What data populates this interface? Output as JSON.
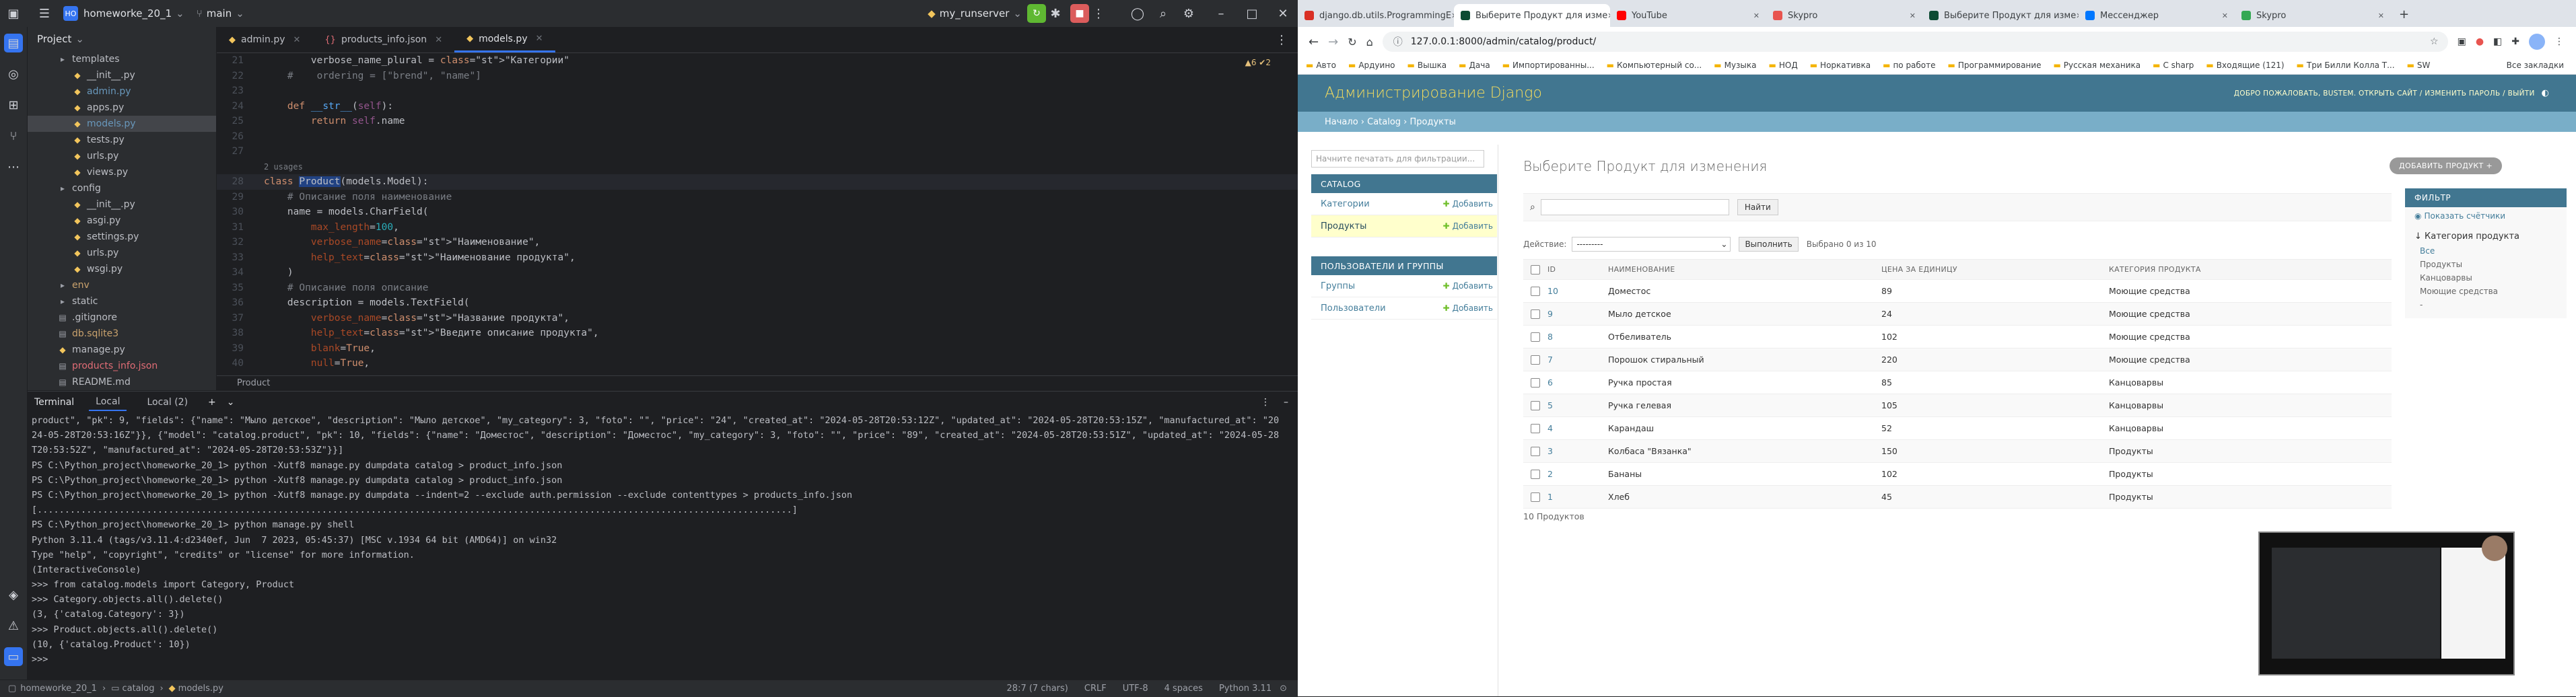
{
  "ide": {
    "project_name": "homeworke_20_1",
    "project_badge": "HO",
    "branch": "main",
    "run_config": "my_runserver",
    "project_panel_title": "Project",
    "tree": [
      {
        "name": "templates",
        "indent": 2,
        "icon": "folder"
      },
      {
        "name": "__init__.py",
        "indent": 3,
        "icon": "py"
      },
      {
        "name": "admin.py",
        "indent": 3,
        "icon": "py",
        "color": "#6897bb"
      },
      {
        "name": "apps.py",
        "indent": 3,
        "icon": "py"
      },
      {
        "name": "models.py",
        "indent": 3,
        "icon": "py",
        "color": "#6897bb",
        "selected": true
      },
      {
        "name": "tests.py",
        "indent": 3,
        "icon": "py"
      },
      {
        "name": "urls.py",
        "indent": 3,
        "icon": "py"
      },
      {
        "name": "views.py",
        "indent": 3,
        "icon": "py"
      },
      {
        "name": "config",
        "indent": 2,
        "icon": "folder"
      },
      {
        "name": "__init__.py",
        "indent": 3,
        "icon": "py"
      },
      {
        "name": "asgi.py",
        "indent": 3,
        "icon": "py"
      },
      {
        "name": "settings.py",
        "indent": 3,
        "icon": "py"
      },
      {
        "name": "urls.py",
        "indent": 3,
        "icon": "py"
      },
      {
        "name": "wsgi.py",
        "indent": 3,
        "icon": "py"
      },
      {
        "name": "env",
        "indent": 2,
        "icon": "folder",
        "color": "#c9a26d"
      },
      {
        "name": "static",
        "indent": 2,
        "icon": "folder"
      },
      {
        "name": ".gitignore",
        "indent": 2,
        "icon": "file"
      },
      {
        "name": "db.sqlite3",
        "indent": 2,
        "icon": "file",
        "color": "#c9a26d"
      },
      {
        "name": "manage.py",
        "indent": 2,
        "icon": "py"
      },
      {
        "name": "products_info.json",
        "indent": 2,
        "icon": "file",
        "color": "#e06c75"
      },
      {
        "name": "README.md",
        "indent": 2,
        "icon": "file"
      }
    ],
    "tabs": [
      {
        "label": "admin.py",
        "active": false
      },
      {
        "label": "products_info.json",
        "active": false
      },
      {
        "label": "models.py",
        "active": true
      }
    ],
    "inspections": "▲6 ✔2",
    "usages_hint": "2 usages",
    "code_lines": [
      {
        "n": "21",
        "t": "        verbose_name_plural = \"Категории\""
      },
      {
        "n": "22",
        "t": "    #    ordering = [\"brend\", \"name\"]"
      },
      {
        "n": "23",
        "t": ""
      },
      {
        "n": "24",
        "t": "    def __str__(self):"
      },
      {
        "n": "25",
        "t": "        return self.name"
      },
      {
        "n": "26",
        "t": ""
      },
      {
        "n": "27",
        "t": ""
      },
      {
        "n": "28",
        "t": "class Product(models.Model):"
      },
      {
        "n": "29",
        "t": "    # Описание поля наименование"
      },
      {
        "n": "30",
        "t": "    name = models.CharField("
      },
      {
        "n": "31",
        "t": "        max_length=100,"
      },
      {
        "n": "32",
        "t": "        verbose_name=\"Наименование\","
      },
      {
        "n": "33",
        "t": "        help_text=\"Наименование продукта\","
      },
      {
        "n": "34",
        "t": "    )"
      },
      {
        "n": "35",
        "t": "    # Описание поля описание"
      },
      {
        "n": "36",
        "t": "    description = models.TextField("
      },
      {
        "n": "37",
        "t": "        verbose_name=\"Название продукта\","
      },
      {
        "n": "38",
        "t": "        help_text=\"Введите описание продукта\","
      },
      {
        "n": "39",
        "t": "        blank=True,"
      },
      {
        "n": "40",
        "t": "        null=True,"
      }
    ],
    "editor_breadcrumb": "Product",
    "terminal": {
      "title": "Terminal",
      "tabs": [
        "Local",
        "Local (2)"
      ],
      "lines": [
        "product\", \"pk\": 9, \"fields\": {\"name\": \"Мыло детское\", \"description\": \"Мыло детское\", \"my_category\": 3, \"foto\": \"\", \"price\": \"24\", \"created_at\": \"2024-05-28T20:53:12Z\", \"updated_at\": \"2024-05-28T20:53:15Z\", \"manufactured_at\": \"20",
        "24-05-28T20:53:16Z\"}}, {\"model\": \"catalog.product\", \"pk\": 10, \"fields\": {\"name\": \"Доместос\", \"description\": \"Доместос\", \"my_category\": 3, \"foto\": \"\", \"price\": \"89\", \"created_at\": \"2024-05-28T20:53:51Z\", \"updated_at\": \"2024-05-28",
        "T20:53:52Z\", \"manufactured_at\": \"2024-05-28T20:53:53Z\"}}]",
        "PS C:\\Python_project\\homeworke_20_1> python -Xutf8 manage.py dumpdata catalog > product_info.json",
        "PS C:\\Python_project\\homeworke_20_1> python -Xutf8 manage.py dumpdata catalog > product_info.json",
        "PS C:\\Python_project\\homeworke_20_1> python -Xutf8 manage.py dumpdata --indent=2 --exclude auth.permission --exclude contenttypes > products_info.json",
        "[..........................................................................................................................................]",
        "PS C:\\Python_project\\homeworke_20_1> python manage.py shell",
        "Python 3.11.4 (tags/v3.11.4:d2340ef, Jun  7 2023, 05:45:37) [MSC v.1934 64 bit (AMD64)] on win32",
        "Type \"help\", \"copyright\", \"credits\" or \"license\" for more information.",
        "(InteractiveConsole)",
        ">>> from catalog.models import Category, Product",
        ">>> Category.objects.all().delete()",
        "(3, {'catalog.Category': 3})",
        ">>> Product.objects.all().delete()",
        "(10, {'catalog.Product': 10})",
        ">>> "
      ]
    },
    "status": {
      "path": [
        "homeworke_20_1",
        "catalog",
        "models.py"
      ],
      "position": "28:7 (7 chars)",
      "line_ending": "CRLF",
      "encoding": "UTF-8",
      "indent": "4 spaces",
      "interpreter": "Python 3.11"
    }
  },
  "browser": {
    "tabs": [
      {
        "label": "django.db.utils.ProgrammingE",
        "fav": "#d93025",
        "active": false
      },
      {
        "label": "Выберите Продукт для изме",
        "fav": "#0c4b33",
        "active": true
      },
      {
        "label": "YouTube",
        "fav": "#ff0000",
        "active": false
      },
      {
        "label": "Skypro",
        "fav": "#e8544f",
        "active": false
      },
      {
        "label": "Выберите Продукт для изме",
        "fav": "#0c4b33",
        "active": false
      },
      {
        "label": "Мессенджер",
        "fav": "#0077ff",
        "active": false
      },
      {
        "label": "Skypro",
        "fav": "#34a853",
        "active": false
      }
    ],
    "url": "127.0.0.1:8000/admin/catalog/product/",
    "bookmarks": [
      "Авто",
      "Ардуино",
      "Вышка",
      "Дача",
      "Импортированны...",
      "Компьютерный со...",
      "Музыка",
      "НОД",
      "Норкативка",
      "по работе",
      "Программирование",
      "Русская механика",
      "C sharp",
      "Входящие (121)",
      "Три Билли Колла Т...",
      "SW"
    ],
    "bookmarks_right": "Все закладки"
  },
  "django": {
    "brand": "Администрирование Django",
    "user_tools": "ДОБРО ПОЖАЛОВАТЬ, BUSTEM. ОТКРЫТЬ САЙТ / ИЗМЕНИТЬ ПАРОЛЬ / ВЫЙТИ",
    "breadcrumbs": "Начало › Catalog › Продукты",
    "nav_filter_placeholder": "Начните печатать для фильтрации...",
    "modules": [
      {
        "caption": "CATALOG",
        "rows": [
          {
            "label": "Категории",
            "add": "Добавить",
            "current": false
          },
          {
            "label": "Продукты",
            "add": "Добавить",
            "current": true
          }
        ]
      },
      {
        "caption": "ПОЛЬЗОВАТЕЛИ И ГРУППЫ",
        "rows": [
          {
            "label": "Группы",
            "add": "Добавить",
            "current": false
          },
          {
            "label": "Пользователи",
            "add": "Добавить",
            "current": false
          }
        ]
      }
    ],
    "title": "Выберите Продукт для изменения",
    "add_button": "ДОБАВИТЬ ПРОДУКТ +",
    "search_button": "Найти",
    "action_label": "Действие:",
    "action_value": "---------",
    "action_go": "Выполнить",
    "selected_count": "Выбрано 0 из 10",
    "columns": [
      "ID",
      "НАИМЕНОВАНИЕ",
      "ЦЕНА ЗА ЕДИНИЦУ",
      "КАТЕГОРИЯ ПРОДУКТА"
    ],
    "rows": [
      {
        "id": "10",
        "name": "Доместос",
        "price": "89",
        "category": "Моющие средства"
      },
      {
        "id": "9",
        "name": "Мыло детское",
        "price": "24",
        "category": "Моющие средства"
      },
      {
        "id": "8",
        "name": "Отбеливатель",
        "price": "102",
        "category": "Моющие средства"
      },
      {
        "id": "7",
        "name": "Порошок стиральный",
        "price": "220",
        "category": "Моющие средства"
      },
      {
        "id": "6",
        "name": "Ручка простая",
        "price": "85",
        "category": "Канцоварвы"
      },
      {
        "id": "5",
        "name": "Ручка гелевая",
        "price": "105",
        "category": "Канцоварвы"
      },
      {
        "id": "4",
        "name": "Карандаш",
        "price": "52",
        "category": "Канцоварвы"
      },
      {
        "id": "3",
        "name": "Колбаса \"Вязанка\"",
        "price": "150",
        "category": "Продукты"
      },
      {
        "id": "2",
        "name": "Бананы",
        "price": "102",
        "category": "Продукты"
      },
      {
        "id": "1",
        "name": "Хлеб",
        "price": "45",
        "category": "Продукты"
      }
    ],
    "count_text": "10 Продуктов",
    "filter": {
      "caption": "ФИЛЬТР",
      "show_counts": "Показать счётчики",
      "heading": "↓ Категория продукта",
      "options": [
        "Все",
        "Продукты",
        "Канцоварвы",
        "Моющие средства",
        "-"
      ]
    }
  }
}
